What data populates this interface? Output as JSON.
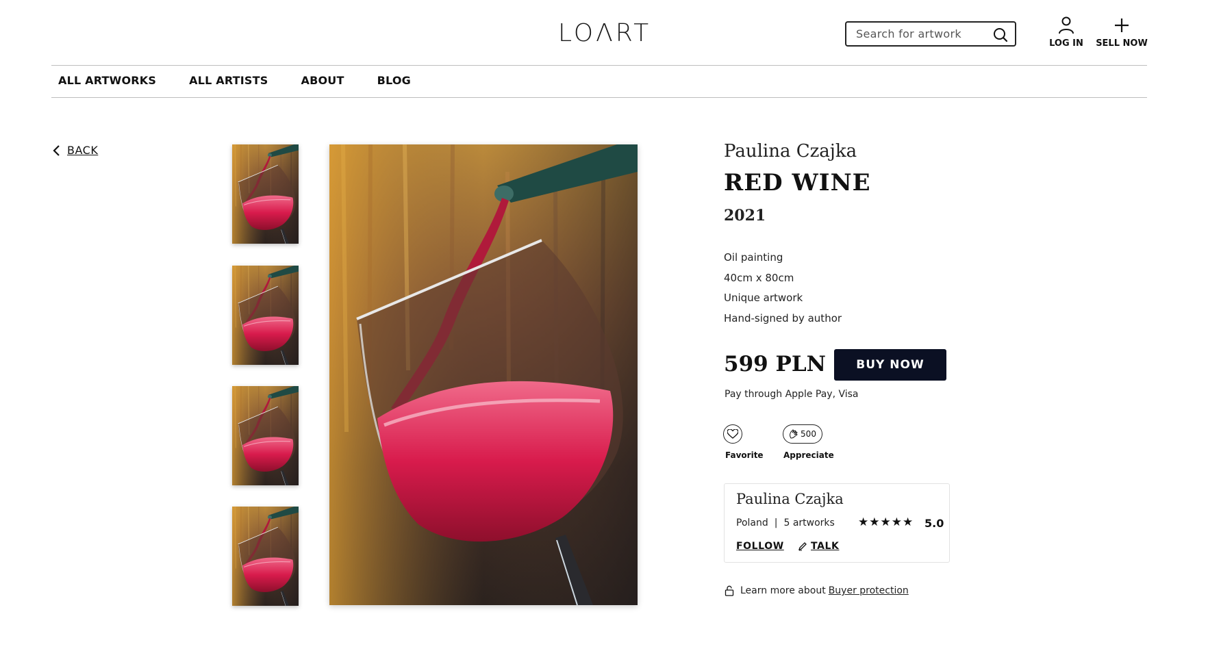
{
  "header": {
    "logo": "LOΛRT",
    "search_placeholder": "Search for artwork",
    "login_label": "LOG IN",
    "sell_label": "SELL NOW"
  },
  "nav": [
    "ALL ARTWORKS",
    "ALL ARTISTS",
    "ABOUT",
    "BLOG"
  ],
  "back_label": "BACK",
  "artwork": {
    "artist": "Paulina Czajka",
    "title": "RED WINE",
    "year": "2021",
    "specs": [
      "Oil painting",
      "40cm x 80cm",
      "Unique artwork",
      "Hand-signed by author"
    ],
    "price": "599 PLN",
    "buy_label": "BUY NOW",
    "payment_note": "Pay through Apple Pay, Visa"
  },
  "actions": {
    "favorite_label": "Favorite",
    "appreciate_count": "500",
    "appreciate_label": "Appreciate"
  },
  "artist_card": {
    "name": "Paulina Czajka",
    "country": "Poland",
    "separator": "|",
    "artworks_count": "5 artworks",
    "stars": "★★★★★",
    "rating": "5.0",
    "follow_label": "FOLLOW",
    "talk_label": "TALK"
  },
  "protection": {
    "text": "Learn more about",
    "link": "Buyer protection"
  },
  "colors": {
    "buy_button": "#0b1023",
    "wine": "#d8194a",
    "background_warm": "#c78a2c"
  }
}
